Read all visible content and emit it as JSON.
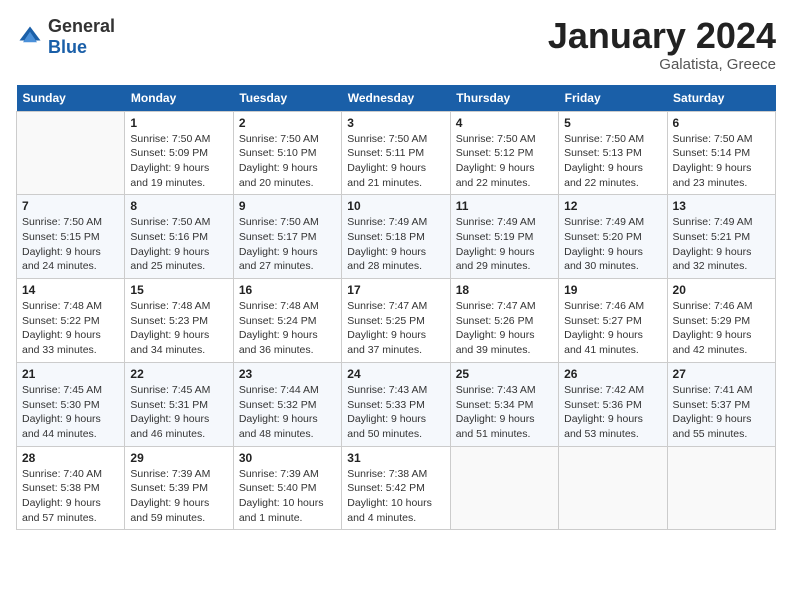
{
  "header": {
    "logo_general": "General",
    "logo_blue": "Blue",
    "month_title": "January 2024",
    "location": "Galatista, Greece"
  },
  "weekdays": [
    "Sunday",
    "Monday",
    "Tuesday",
    "Wednesday",
    "Thursday",
    "Friday",
    "Saturday"
  ],
  "weeks": [
    [
      {
        "day": "",
        "sunrise": "",
        "sunset": "",
        "daylight": ""
      },
      {
        "day": "1",
        "sunrise": "Sunrise: 7:50 AM",
        "sunset": "Sunset: 5:09 PM",
        "daylight": "Daylight: 9 hours and 19 minutes."
      },
      {
        "day": "2",
        "sunrise": "Sunrise: 7:50 AM",
        "sunset": "Sunset: 5:10 PM",
        "daylight": "Daylight: 9 hours and 20 minutes."
      },
      {
        "day": "3",
        "sunrise": "Sunrise: 7:50 AM",
        "sunset": "Sunset: 5:11 PM",
        "daylight": "Daylight: 9 hours and 21 minutes."
      },
      {
        "day": "4",
        "sunrise": "Sunrise: 7:50 AM",
        "sunset": "Sunset: 5:12 PM",
        "daylight": "Daylight: 9 hours and 22 minutes."
      },
      {
        "day": "5",
        "sunrise": "Sunrise: 7:50 AM",
        "sunset": "Sunset: 5:13 PM",
        "daylight": "Daylight: 9 hours and 22 minutes."
      },
      {
        "day": "6",
        "sunrise": "Sunrise: 7:50 AM",
        "sunset": "Sunset: 5:14 PM",
        "daylight": "Daylight: 9 hours and 23 minutes."
      }
    ],
    [
      {
        "day": "7",
        "sunrise": "Sunrise: 7:50 AM",
        "sunset": "Sunset: 5:15 PM",
        "daylight": "Daylight: 9 hours and 24 minutes."
      },
      {
        "day": "8",
        "sunrise": "Sunrise: 7:50 AM",
        "sunset": "Sunset: 5:16 PM",
        "daylight": "Daylight: 9 hours and 25 minutes."
      },
      {
        "day": "9",
        "sunrise": "Sunrise: 7:50 AM",
        "sunset": "Sunset: 5:17 PM",
        "daylight": "Daylight: 9 hours and 27 minutes."
      },
      {
        "day": "10",
        "sunrise": "Sunrise: 7:49 AM",
        "sunset": "Sunset: 5:18 PM",
        "daylight": "Daylight: 9 hours and 28 minutes."
      },
      {
        "day": "11",
        "sunrise": "Sunrise: 7:49 AM",
        "sunset": "Sunset: 5:19 PM",
        "daylight": "Daylight: 9 hours and 29 minutes."
      },
      {
        "day": "12",
        "sunrise": "Sunrise: 7:49 AM",
        "sunset": "Sunset: 5:20 PM",
        "daylight": "Daylight: 9 hours and 30 minutes."
      },
      {
        "day": "13",
        "sunrise": "Sunrise: 7:49 AM",
        "sunset": "Sunset: 5:21 PM",
        "daylight": "Daylight: 9 hours and 32 minutes."
      }
    ],
    [
      {
        "day": "14",
        "sunrise": "Sunrise: 7:48 AM",
        "sunset": "Sunset: 5:22 PM",
        "daylight": "Daylight: 9 hours and 33 minutes."
      },
      {
        "day": "15",
        "sunrise": "Sunrise: 7:48 AM",
        "sunset": "Sunset: 5:23 PM",
        "daylight": "Daylight: 9 hours and 34 minutes."
      },
      {
        "day": "16",
        "sunrise": "Sunrise: 7:48 AM",
        "sunset": "Sunset: 5:24 PM",
        "daylight": "Daylight: 9 hours and 36 minutes."
      },
      {
        "day": "17",
        "sunrise": "Sunrise: 7:47 AM",
        "sunset": "Sunset: 5:25 PM",
        "daylight": "Daylight: 9 hours and 37 minutes."
      },
      {
        "day": "18",
        "sunrise": "Sunrise: 7:47 AM",
        "sunset": "Sunset: 5:26 PM",
        "daylight": "Daylight: 9 hours and 39 minutes."
      },
      {
        "day": "19",
        "sunrise": "Sunrise: 7:46 AM",
        "sunset": "Sunset: 5:27 PM",
        "daylight": "Daylight: 9 hours and 41 minutes."
      },
      {
        "day": "20",
        "sunrise": "Sunrise: 7:46 AM",
        "sunset": "Sunset: 5:29 PM",
        "daylight": "Daylight: 9 hours and 42 minutes."
      }
    ],
    [
      {
        "day": "21",
        "sunrise": "Sunrise: 7:45 AM",
        "sunset": "Sunset: 5:30 PM",
        "daylight": "Daylight: 9 hours and 44 minutes."
      },
      {
        "day": "22",
        "sunrise": "Sunrise: 7:45 AM",
        "sunset": "Sunset: 5:31 PM",
        "daylight": "Daylight: 9 hours and 46 minutes."
      },
      {
        "day": "23",
        "sunrise": "Sunrise: 7:44 AM",
        "sunset": "Sunset: 5:32 PM",
        "daylight": "Daylight: 9 hours and 48 minutes."
      },
      {
        "day": "24",
        "sunrise": "Sunrise: 7:43 AM",
        "sunset": "Sunset: 5:33 PM",
        "daylight": "Daylight: 9 hours and 50 minutes."
      },
      {
        "day": "25",
        "sunrise": "Sunrise: 7:43 AM",
        "sunset": "Sunset: 5:34 PM",
        "daylight": "Daylight: 9 hours and 51 minutes."
      },
      {
        "day": "26",
        "sunrise": "Sunrise: 7:42 AM",
        "sunset": "Sunset: 5:36 PM",
        "daylight": "Daylight: 9 hours and 53 minutes."
      },
      {
        "day": "27",
        "sunrise": "Sunrise: 7:41 AM",
        "sunset": "Sunset: 5:37 PM",
        "daylight": "Daylight: 9 hours and 55 minutes."
      }
    ],
    [
      {
        "day": "28",
        "sunrise": "Sunrise: 7:40 AM",
        "sunset": "Sunset: 5:38 PM",
        "daylight": "Daylight: 9 hours and 57 minutes."
      },
      {
        "day": "29",
        "sunrise": "Sunrise: 7:39 AM",
        "sunset": "Sunset: 5:39 PM",
        "daylight": "Daylight: 9 hours and 59 minutes."
      },
      {
        "day": "30",
        "sunrise": "Sunrise: 7:39 AM",
        "sunset": "Sunset: 5:40 PM",
        "daylight": "Daylight: 10 hours and 1 minute."
      },
      {
        "day": "31",
        "sunrise": "Sunrise: 7:38 AM",
        "sunset": "Sunset: 5:42 PM",
        "daylight": "Daylight: 10 hours and 4 minutes."
      },
      {
        "day": "",
        "sunrise": "",
        "sunset": "",
        "daylight": ""
      },
      {
        "day": "",
        "sunrise": "",
        "sunset": "",
        "daylight": ""
      },
      {
        "day": "",
        "sunrise": "",
        "sunset": "",
        "daylight": ""
      }
    ]
  ]
}
